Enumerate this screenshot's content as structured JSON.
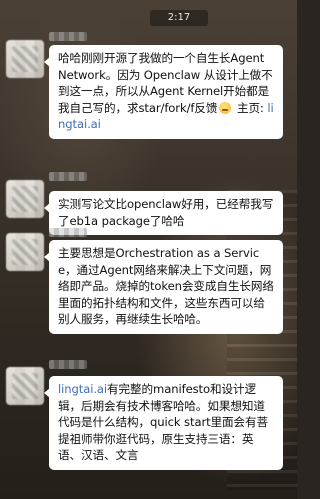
{
  "status_bar": {
    "time": "2:17"
  },
  "messages": [
    {
      "parts": [
        "哈哈刚刚开源了我做的一个自生长Agent Network。因为 Openclaw 从设计上做不到这一点，所以从Agent Kernel开始都是我自己写的，求star/fork/f反馈",
        " 主页: ",
        "lingtai.ai"
      ],
      "emoji": "sweat-smile-emoji"
    },
    {
      "text": "实测写论文比openclaw好用，已经帮我写了eb1a package了哈哈"
    },
    {
      "text": "主要思想是Orchestration as a Service，通过Agent网络来解决上下文问题，网络即产品。烧掉的token会变成自生长网络里面的拓扑结构和文件，这些东西可以给别人服务，再继续生长哈哈。"
    },
    {
      "parts": [
        "lingtai.ai",
        "有完整的manifesto和设计逻辑，后期会有技术博客哈哈。如果想知道代码是什么结构，quick start里面会有菩提祖师带你逛代码，原生支持三语：英语、汉语、文言"
      ]
    }
  ]
}
